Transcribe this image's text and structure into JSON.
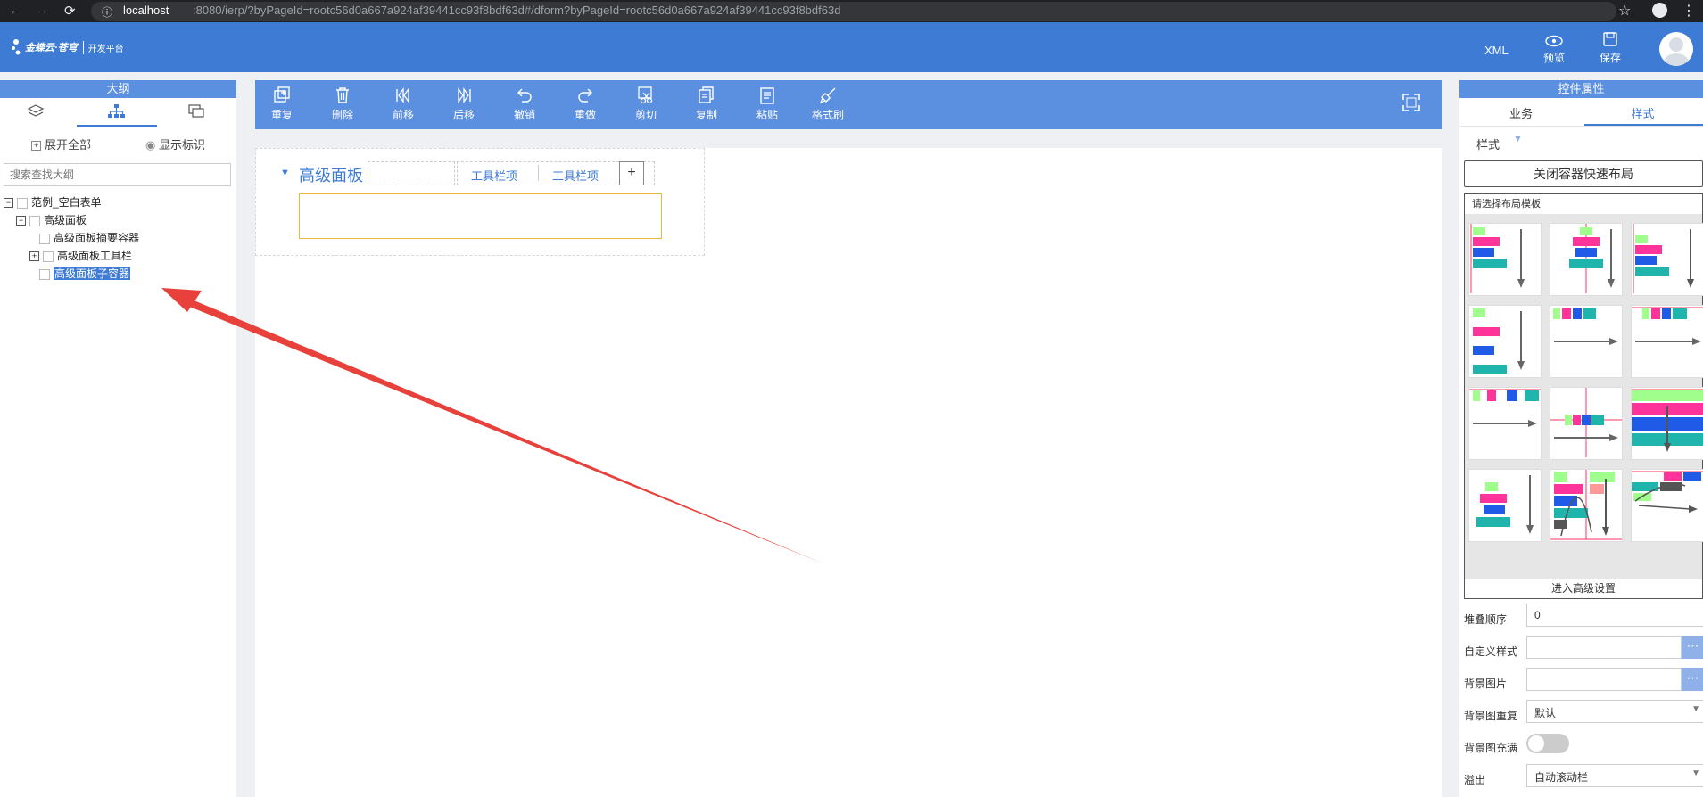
{
  "browser": {
    "url_host": "localhost",
    "url_rest": ":8080/ierp/?byPageId=rootc56d0a667a924af39441cc93f8bdf63d#/dform?byPageId=rootc56d0a667a924af39441cc93f8bdf63d"
  },
  "header": {
    "logo_text": "金蝶云·苍穹",
    "logo_sub": "开发平台",
    "xml_label": "XML",
    "preview_label": "预览",
    "save_label": "保存"
  },
  "outline": {
    "title": "大纲",
    "expand_all": "展开全部",
    "show_marks": "显示标识",
    "search_placeholder": "搜索查找大纲",
    "tree": [
      {
        "label": "范例_空白表单"
      },
      {
        "label": "高级面板"
      },
      {
        "label": "高级面板摘要容器"
      },
      {
        "label": "高级面板工具栏"
      },
      {
        "label": "高级面板子容器"
      }
    ]
  },
  "toolbar": {
    "items": [
      {
        "label": "重复"
      },
      {
        "label": "删除"
      },
      {
        "label": "前移"
      },
      {
        "label": "后移"
      },
      {
        "label": "撤销"
      },
      {
        "label": "重做"
      },
      {
        "label": "剪切"
      },
      {
        "label": "复制"
      },
      {
        "label": "粘贴"
      },
      {
        "label": "格式刷"
      }
    ]
  },
  "canvas": {
    "panel_title": "高级面板",
    "toolbar_item_1": "工具栏项",
    "toolbar_item_2": "工具栏项",
    "add_label": "+"
  },
  "properties": {
    "title": "控件属性",
    "tab_business": "业务",
    "tab_style": "样式",
    "section": "样式",
    "close_layout_btn": "关闭容器快速布局",
    "template_caption": "请选择布局模板",
    "advanced_link": "进入高级设置",
    "fields": [
      {
        "label": "堆叠顺序",
        "value": "0"
      },
      {
        "label": "自定义样式",
        "value": ""
      },
      {
        "label": "背景图片",
        "value": ""
      },
      {
        "label": "背景图重复",
        "value": "默认"
      },
      {
        "label": "背景图充满",
        "value": ""
      },
      {
        "label": "溢出",
        "value": "自动滚动栏"
      }
    ]
  },
  "colors": {
    "header_blue": "#3d7bd5",
    "panel_blue": "#5b8fe0",
    "accent_red": "#e8403b",
    "selected": "#3d7bd5"
  }
}
